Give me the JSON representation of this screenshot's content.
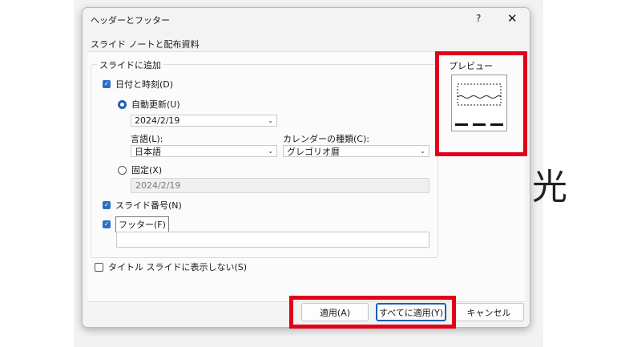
{
  "dialog": {
    "title": "ヘッダーとフッター",
    "help": "?",
    "close": "✕",
    "tab": "スライド ノートと配布資料"
  },
  "group": {
    "title": "スライドに追加",
    "date_time": {
      "label": "日付と時刻(D)",
      "checked": true
    },
    "auto_update": {
      "label": "自動更新(U)",
      "selected": true,
      "value": "2024/2/19"
    },
    "language": {
      "label": "言語(L):",
      "value": "日本語"
    },
    "calendar": {
      "label": "カレンダーの種類(C):",
      "value": "グレゴリオ暦"
    },
    "fixed": {
      "label": "固定(X)",
      "selected": false,
      "value": "2024/2/19"
    },
    "slide_number": {
      "label": "スライド番号(N)",
      "checked": true
    },
    "footer": {
      "label": "フッター(F)",
      "checked": true,
      "value": ""
    }
  },
  "dont_show_on_title": {
    "label": "タイトル スライドに表示しない(S)",
    "checked": false
  },
  "preview": {
    "title": "プレビュー"
  },
  "buttons": {
    "apply": "適用(A)",
    "apply_all": "すべてに適用(Y)",
    "cancel": "キャンセル"
  },
  "background_glyph": "光",
  "colors": {
    "highlight": "#e0001b",
    "accent": "#1a5fb4",
    "checkbox": "#2b6ec4"
  }
}
